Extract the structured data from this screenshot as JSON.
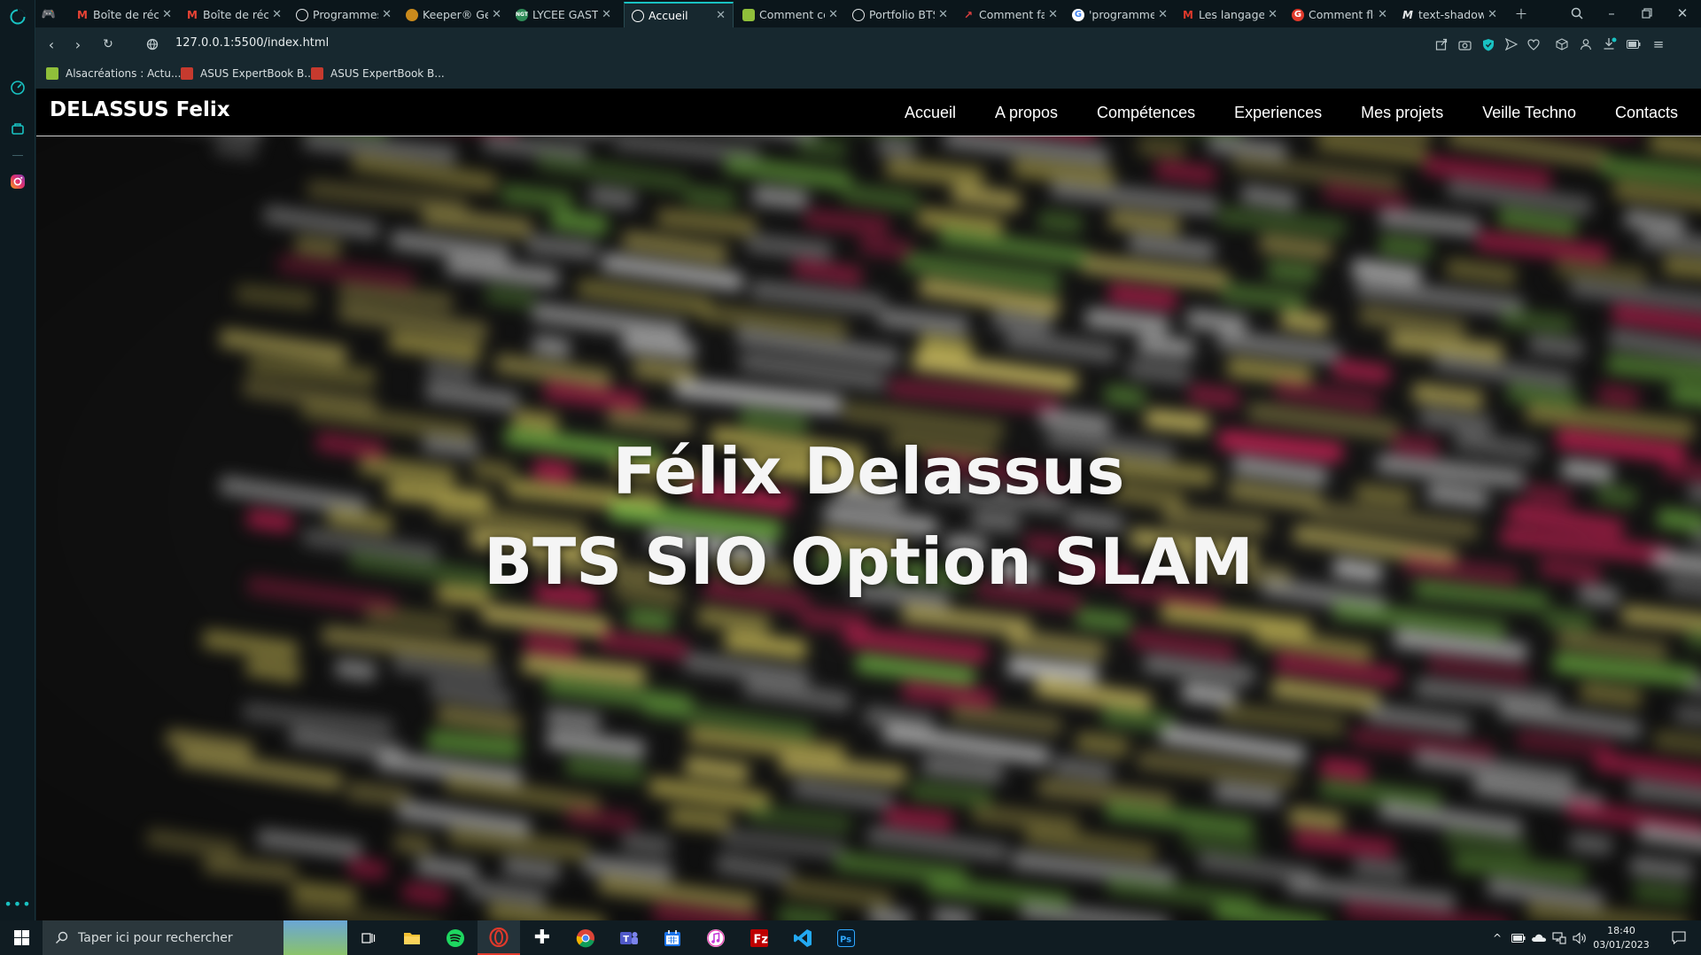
{
  "browser": {
    "tabs": [
      {
        "label": "",
        "icon": "controller-icon"
      },
      {
        "label": "Boîte de récep",
        "icon": "gmail-icon"
      },
      {
        "label": "Boîte de récep",
        "icon": "gmail-icon"
      },
      {
        "label": "Programmes",
        "icon": "globe-icon"
      },
      {
        "label": "Keeper® Gen",
        "icon": "keeper-icon"
      },
      {
        "label": "LYCEE GASTON",
        "icon": "ngt-icon"
      },
      {
        "label": "Accueil",
        "icon": "globe-icon",
        "active": true
      },
      {
        "label": "Comment cen",
        "icon": "alsacreations-icon"
      },
      {
        "label": "Portfolio BTS",
        "icon": "globe-icon"
      },
      {
        "label": "Comment fair",
        "icon": "arrow-icon"
      },
      {
        "label": "'programme",
        "icon": "google-icon"
      },
      {
        "label": "Les langages",
        "icon": "m-icon"
      },
      {
        "label": "Comment flo",
        "icon": "g-icon"
      },
      {
        "label": "text-shadow",
        "icon": "mdn-icon"
      }
    ],
    "url": "127.0.0.1:5500/index.html",
    "bookmarks": [
      {
        "label": "Alsacréations : Actu...",
        "icon": "alsacreations-icon"
      },
      {
        "label": "ASUS ExpertBook B...",
        "icon": "gift-icon"
      },
      {
        "label": "ASUS ExpertBook B...",
        "icon": "gift-icon"
      }
    ],
    "colors": {
      "accent": "#19c2c2",
      "chrome": "#17282f"
    }
  },
  "site": {
    "brand": "DELASSUS Felix",
    "menu": [
      "Accueil",
      "A propos",
      "Compétences",
      "Experiences",
      "Mes projets",
      "Veille Techno",
      "Contacts"
    ],
    "hero_line1": "Félix Delassus",
    "hero_line2": "BTS SIO Option SLAM"
  },
  "taskbar": {
    "search_placeholder": "Taper ici pour rechercher",
    "time": "18:40",
    "date": "03/01/2023",
    "apps": [
      "task-view-icon",
      "file-explorer-icon",
      "spotify-icon",
      "opera-icon",
      "plus-app-icon",
      "chrome-icon",
      "teams-icon",
      "calendar-icon",
      "itunes-icon",
      "filezilla-icon",
      "vscode-icon",
      "photoshop-icon"
    ]
  }
}
